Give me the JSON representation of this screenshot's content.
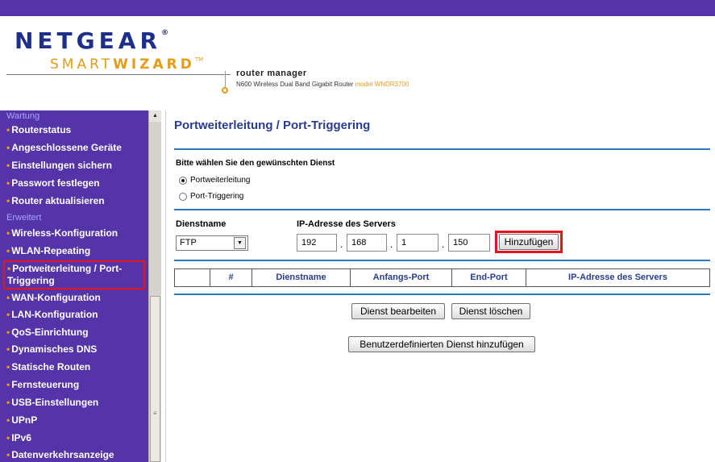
{
  "header": {
    "logo_main": "NETGEAR",
    "logo_main_mark": "®",
    "logo_sub_light": "SMART",
    "logo_sub_bold": "WIZARD",
    "logo_sub_mark": "TM",
    "app_name": "router manager",
    "device_desc": "N600 Wireless Dual Band Gigabit Router",
    "model_label": "model WNDR3700"
  },
  "sidebar": {
    "sections": [
      {
        "label": "Wartung",
        "items": [
          "Routerstatus",
          "Angeschlossene Geräte",
          "Einstellungen sichern",
          "Passwort festlegen",
          "Router aktualisieren"
        ]
      },
      {
        "label": "Erweitert",
        "items": [
          "Wireless-Konfiguration",
          "WLAN-Repeating",
          "Portweiterleitung / Port-Triggering",
          "WAN-Konfiguration",
          "LAN-Konfiguration",
          "QoS-Einrichtung",
          "Dynamisches DNS",
          "Statische Routen",
          "Fernsteuerung",
          "USB-Einstellungen",
          "UPnP",
          "IPv6",
          "Datenverkehrsanzeige"
        ]
      }
    ],
    "active_item": "Portweiterleitung / Port-Triggering"
  },
  "main": {
    "title": "Portweiterleitung / Port-Triggering",
    "service_prompt": "Bitte wählen Sie den gewünschten Dienst",
    "radio_options": [
      {
        "label": "Portweiterleitung",
        "checked": true
      },
      {
        "label": "Port-Triggering",
        "checked": false
      }
    ],
    "service_name_label": "Dienstname",
    "service_name_value": "FTP",
    "server_ip_label": "IP-Adresse des Servers",
    "ip_octets": [
      "192",
      "168",
      "1",
      "150"
    ],
    "add_button": "Hinzufügen",
    "table_headers": [
      "",
      "#",
      "Dienstname",
      "Anfangs-Port",
      "End-Port",
      "IP-Adresse des Servers"
    ],
    "edit_button": "Dienst bearbeiten",
    "delete_button": "Dienst löschen",
    "add_custom_button": "Benutzerdefinierten Dienst hinzufügen"
  },
  "colors": {
    "sidebar_bg": "#5533a8",
    "brand_blue": "#1d2f88",
    "brand_orange": "#e59c14",
    "highlight_red": "#e8141a",
    "rule_blue": "#2a7ac0"
  },
  "icons": {
    "scroll_up": "▲",
    "dropdown": "▼",
    "grip": "≡"
  }
}
